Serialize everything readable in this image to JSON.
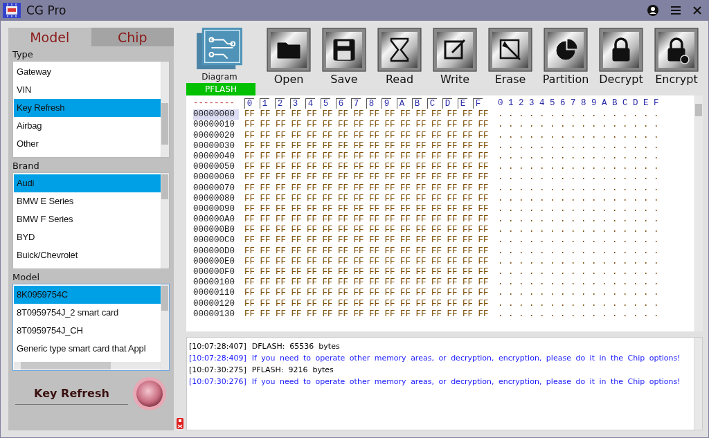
{
  "window": {
    "title": "CG Pro"
  },
  "tabs": [
    {
      "label": "Model",
      "selected": true
    },
    {
      "label": "Chip",
      "selected": false
    }
  ],
  "lists": [
    {
      "label": "Type",
      "items": [
        {
          "label": "Gateway",
          "selected": false
        },
        {
          "label": "VIN",
          "selected": false
        },
        {
          "label": "Key Refresh",
          "selected": true
        },
        {
          "label": "Airbag",
          "selected": false
        },
        {
          "label": "Other",
          "selected": false
        }
      ]
    },
    {
      "label": "Brand",
      "items": [
        {
          "label": "Audi",
          "selected": true
        },
        {
          "label": "BMW E Series",
          "selected": false
        },
        {
          "label": "BMW F Series",
          "selected": false
        },
        {
          "label": "BYD",
          "selected": false
        },
        {
          "label": "Buick/Chevrolet",
          "selected": false
        }
      ]
    },
    {
      "label": "Model",
      "items": [
        {
          "label": "8K0959754C",
          "selected": true
        },
        {
          "label": "8T0959754J_2 smart card",
          "selected": false
        },
        {
          "label": "8T0959754J_CH",
          "selected": false
        },
        {
          "label": "Generic type smart card that Appl",
          "selected": false
        }
      ]
    }
  ],
  "function_label": "Key Refresh",
  "toolbar": [
    {
      "kind": "diagram",
      "label": "Diagram"
    },
    {
      "kind": "open",
      "label": "Open"
    },
    {
      "kind": "save",
      "label": "Save"
    },
    {
      "kind": "read",
      "label": "Read"
    },
    {
      "kind": "write",
      "label": "Write"
    },
    {
      "kind": "erase",
      "label": "Erase"
    },
    {
      "kind": "partition",
      "label": "Partition"
    },
    {
      "kind": "decrypt",
      "label": "Decrypt"
    },
    {
      "kind": "encrypt",
      "label": "Encrypt"
    }
  ],
  "memory_tab": "PFLASH",
  "hex": {
    "corner": "--------",
    "columns": [
      "0",
      "1",
      "2",
      "3",
      "4",
      "5",
      "6",
      "7",
      "8",
      "9",
      "A",
      "B",
      "C",
      "D",
      "E",
      "F"
    ],
    "ascii_header": "0 1 2 3 4 5 6 7 8 9 A B C D E F",
    "rows": [
      {
        "address": "00000000",
        "selected": true,
        "bytes": "FF FF FF FF FF FF FF FF FF FF FF FF FF FF FF FF",
        "ascii": ". . . . . . . . . . . . . . . ."
      },
      {
        "address": "00000010",
        "selected": false,
        "bytes": "FF FF FF FF FF FF FF FF FF FF FF FF FF FF FF FF",
        "ascii": ". . . . . . . . . . . . . . . ."
      },
      {
        "address": "00000020",
        "selected": false,
        "bytes": "FF FF FF FF FF FF FF FF FF FF FF FF FF FF FF FF",
        "ascii": ". . . . . . . . . . . . . . . ."
      },
      {
        "address": "00000030",
        "selected": false,
        "bytes": "FF FF FF FF FF FF FF FF FF FF FF FF FF FF FF FF",
        "ascii": ". . . . . . . . . . . . . . . ."
      },
      {
        "address": "00000040",
        "selected": false,
        "bytes": "FF FF FF FF FF FF FF FF FF FF FF FF FF FF FF FF",
        "ascii": ". . . . . . . . . . . . . . . ."
      },
      {
        "address": "00000050",
        "selected": false,
        "bytes": "FF FF FF FF FF FF FF FF FF FF FF FF FF FF FF FF",
        "ascii": ". . . . . . . . . . . . . . . ."
      },
      {
        "address": "00000060",
        "selected": false,
        "bytes": "FF FF FF FF FF FF FF FF FF FF FF FF FF FF FF FF",
        "ascii": ". . . . . . . . . . . . . . . ."
      },
      {
        "address": "00000070",
        "selected": false,
        "bytes": "FF FF FF FF FF FF FF FF FF FF FF FF FF FF FF FF",
        "ascii": ". . . . . . . . . . . . . . . ."
      },
      {
        "address": "00000080",
        "selected": false,
        "bytes": "FF FF FF FF FF FF FF FF FF FF FF FF FF FF FF FF",
        "ascii": ". . . . . . . . . . . . . . . ."
      },
      {
        "address": "00000090",
        "selected": false,
        "bytes": "FF FF FF FF FF FF FF FF FF FF FF FF FF FF FF FF",
        "ascii": ". . . . . . . . . . . . . . . ."
      },
      {
        "address": "000000A0",
        "selected": false,
        "bytes": "FF FF FF FF FF FF FF FF FF FF FF FF FF FF FF FF",
        "ascii": ". . . . . . . . . . . . . . . ."
      },
      {
        "address": "000000B0",
        "selected": false,
        "bytes": "FF FF FF FF FF FF FF FF FF FF FF FF FF FF FF FF",
        "ascii": ". . . . . . . . . . . . . . . ."
      },
      {
        "address": "000000C0",
        "selected": false,
        "bytes": "FF FF FF FF FF FF FF FF FF FF FF FF FF FF FF FF",
        "ascii": ". . . . . . . . . . . . . . . ."
      },
      {
        "address": "000000D0",
        "selected": false,
        "bytes": "FF FF FF FF FF FF FF FF FF FF FF FF FF FF FF FF",
        "ascii": ". . . . . . . . . . . . . . . ."
      },
      {
        "address": "000000E0",
        "selected": false,
        "bytes": "FF FF FF FF FF FF FF FF FF FF FF FF FF FF FF FF",
        "ascii": ". . . . . . . . . . . . . . . ."
      },
      {
        "address": "000000F0",
        "selected": false,
        "bytes": "FF FF FF FF FF FF FF FF FF FF FF FF FF FF FF FF",
        "ascii": ". . . . . . . . . . . . . . . ."
      },
      {
        "address": "00000100",
        "selected": false,
        "bytes": "FF FF FF FF FF FF FF FF FF FF FF FF FF FF FF FF",
        "ascii": ". . . . . . . . . . . . . . . ."
      },
      {
        "address": "00000110",
        "selected": false,
        "bytes": "FF FF FF FF FF FF FF FF FF FF FF FF FF FF FF FF",
        "ascii": ". . . . . . . . . . . . . . . ."
      },
      {
        "address": "00000120",
        "selected": false,
        "bytes": "FF FF FF FF FF FF FF FF FF FF FF FF FF FF FF FF",
        "ascii": ". . . . . . . . . . . . . . . ."
      },
      {
        "address": "00000130",
        "selected": false,
        "bytes": "FF FF FF FF FF FF FF FF FF FF FF FF FF FF FF FF",
        "ascii": ". . . . . . . . . . . . . . . ."
      }
    ]
  },
  "log": [
    {
      "kind": "info",
      "time": "[10:07:28:407]",
      "message": "DFLASH:  65536  bytes"
    },
    {
      "kind": "notice",
      "time": "[10:07:28:409]",
      "message": "If you need to operate other memory areas, or decryption, encryption, please do it in the Chip options!"
    },
    {
      "kind": "info",
      "time": "[10:07:30:275]",
      "message": "PFLASH:  9216  bytes"
    },
    {
      "kind": "notice",
      "time": "[10:07:30:276]",
      "message": "If you need to operate other memory areas, or decryption, encryption, please do it in the Chip options!"
    }
  ]
}
